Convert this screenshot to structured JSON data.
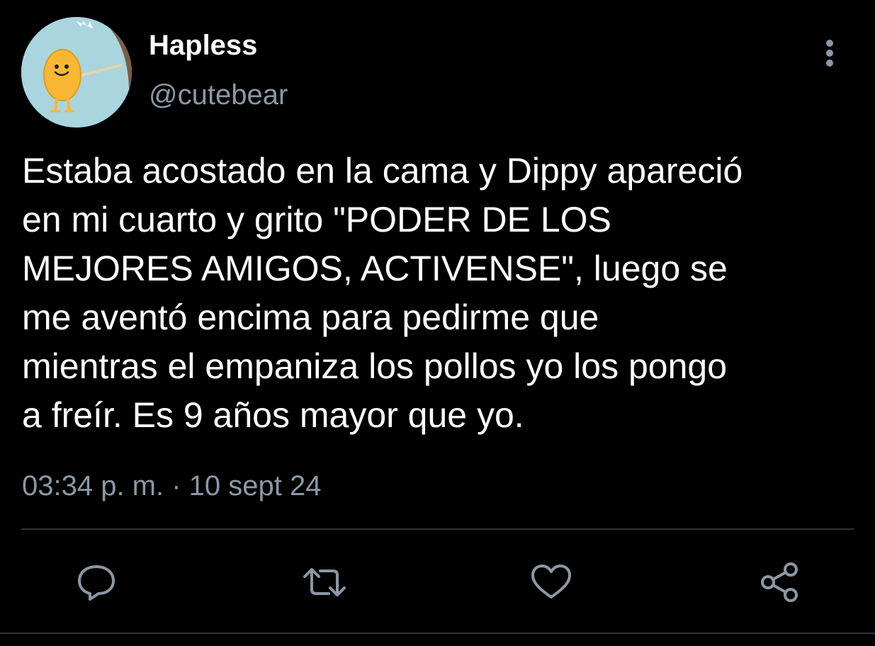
{
  "tweet": {
    "display_name": "Hapless",
    "handle": "@cutebear",
    "text": "Estaba acostado en la cama y Dippy apareció\nen mi cuarto y grito \"PODER DE LOS\nMEJORES AMIGOS, ACTIVENSE\", luego se\nme aventó encima para pedirme que\nmientras el empaniza los pollos yo los pongo\na freír. Es 9 años mayor que yo.",
    "timestamp": "03:34 p. m. · 10 sept 24"
  },
  "icons": {
    "more": "more-vertical-icon",
    "reply": "reply-icon",
    "retweet": "retweet-icon",
    "like": "heart-icon",
    "share": "share-icon"
  },
  "colors": {
    "background": "#000000",
    "text_primary": "#ffffff",
    "text_secondary": "#8b98a5",
    "divider": "#2f3336",
    "avatar_background": "#a9d5df"
  }
}
